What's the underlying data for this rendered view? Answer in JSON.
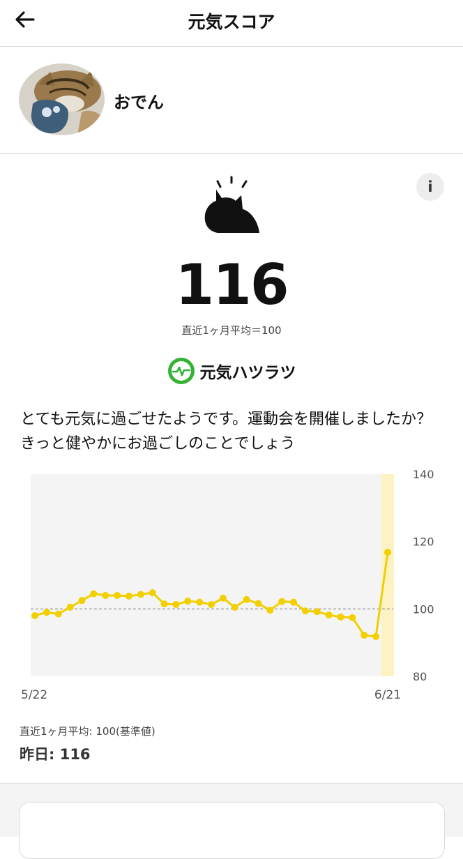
{
  "header": {
    "title": "元気スコア"
  },
  "profile": {
    "name": "おでん"
  },
  "score": {
    "value": "116",
    "avg_text": "直近1ヶ月平均＝100",
    "status": "元気ハツラツ",
    "message": "とても元気に過ごせたようです。運動会を開催しましたか？ きっと健やかにお過ごしのことでしょう"
  },
  "colors": {
    "accent": "#f2cf00",
    "highlight": "#fdf2c4",
    "plot_bg": "#f4f4f4",
    "status_green": "#34b233"
  },
  "chart_data": {
    "type": "line",
    "x_start_label": "5/22",
    "x_end_label": "6/21",
    "ylim": [
      80,
      140
    ],
    "y_ticks": [
      80,
      100,
      120,
      140
    ],
    "baseline": 100,
    "series": [
      {
        "values": [
          98,
          99,
          98.5,
          100.5,
          102.5,
          104.5,
          104,
          104,
          103.8,
          104.3,
          104.8,
          101.5,
          101.3,
          102.3,
          102,
          101.3,
          103.2,
          100.5,
          102.8,
          101.6,
          99.6,
          102.2,
          102,
          99.4,
          99.2,
          98.2,
          97.6,
          97.4,
          92.2,
          91.8,
          116.8
        ]
      }
    ],
    "highlight_last": true,
    "grid": false
  },
  "footer": {
    "avg_text": "直近1ヶ月平均: 100(基準値)",
    "yesterday": "昨日: 116"
  }
}
